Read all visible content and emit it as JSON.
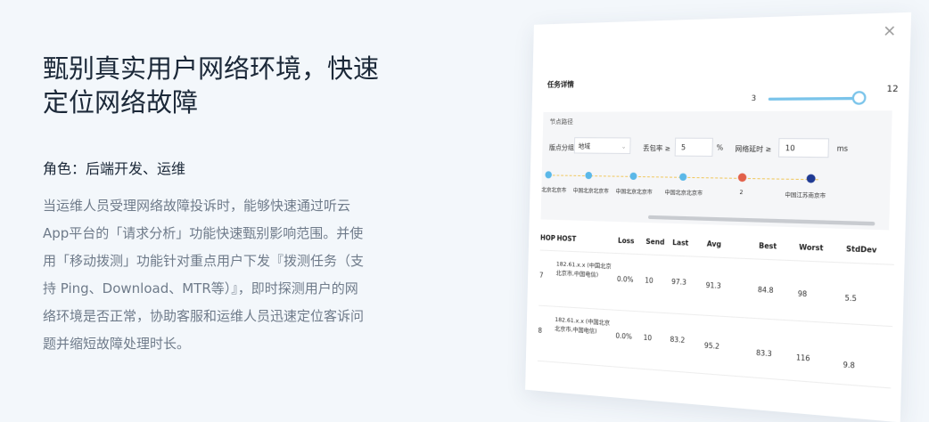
{
  "left": {
    "headline": [
      "甄别真实用户网络环境，快速",
      "定位网络故障"
    ],
    "role": "角色：后端开发、运维",
    "description": [
      "当运维人员受理网络故障投诉时，能够快速通过听云",
      "App平台的「请求分析」功能快速甄别影响范围。并使",
      "用「移动拨测」功能针对重点用户下发『拨测任务（支",
      "持 Ping、Download、MTR等）』，即时探测用户的网",
      "络环境是否正常，协助客服和运维人员迅速定位客诉问",
      "题并缩短故障处理时长。"
    ]
  },
  "panel": {
    "close_glyph": "×",
    "title": "任务详情",
    "slider": {
      "min": "3",
      "max": "12"
    },
    "node_path": {
      "label": "节点路径",
      "filters": {
        "group_label": "版点分组",
        "group_value": "地域",
        "loss_label": "丢包率 ≥",
        "loss_value": "5",
        "loss_unit": "%",
        "latency_label": "网络延时 ≥",
        "latency_value": "10",
        "latency_unit": "ms"
      },
      "nodes": [
        {
          "name": "北京北京市",
          "color": "#5bb8e8"
        },
        {
          "name": "中国北京北京市",
          "color": "#5bb8e8"
        },
        {
          "name": "中国北京北京市",
          "color": "#5bb8e8"
        },
        {
          "name": "中国北京北京市",
          "color": "#5bb8e8"
        },
        {
          "name": "2",
          "color": "#e2614a"
        },
        {
          "name": "中国江苏南京市",
          "color": "#1f3a93"
        }
      ]
    },
    "table": {
      "headers": [
        "HOP",
        "HOST",
        "Loss",
        "Send",
        "Last",
        "Avg",
        "Best",
        "Worst",
        "StdDev"
      ],
      "rows": [
        {
          "hop": "7",
          "host": "182.61.x.x (中国北京北京市,中国电信)",
          "loss": "0.0%",
          "send": "10",
          "last": "97.3",
          "avg": "91.3",
          "best": "84.8",
          "worst": "98",
          "stddev": "5.5"
        },
        {
          "hop": "8",
          "host": "182.61.x.x (中国北京北京市,中国电信)",
          "loss": "0.0%",
          "send": "10",
          "last": "83.2",
          "avg": "95.2",
          "best": "83.3",
          "worst": "116",
          "stddev": "9.8"
        }
      ]
    }
  }
}
